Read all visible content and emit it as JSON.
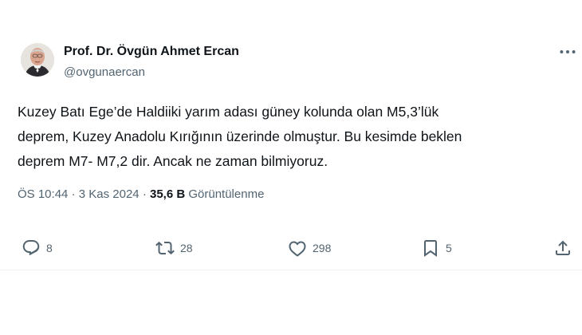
{
  "tweet": {
    "author_name": "Prof. Dr. Övgün Ahmet Ercan",
    "author_handle": "@ovgunaercan",
    "text": "Kuzey Batı Ege’de Haldiiki yarım adası güney kolunda olan M5,3’lük\ndeprem, Kuzey Anadolu Kırığının üzerinde olmuştur. Bu kesimde beklen\ndeprem M7- M7,2 dir. Ancak ne zaman bilmiyoruz.",
    "time": "ÖS 10:44",
    "separator": "·",
    "date": "3 Kas 2024",
    "views_count": "35,6 B",
    "views_label": "Görüntülenme"
  },
  "actions": {
    "replies": "8",
    "reposts": "28",
    "likes": "298",
    "bookmarks": "5"
  },
  "icons": {
    "more": "more-icon",
    "reply": "reply-icon",
    "repost": "repost-icon",
    "like": "heart-icon",
    "bookmark": "bookmark-icon",
    "share": "share-icon"
  },
  "colors": {
    "text": "#0f1419",
    "secondary": "#536471"
  }
}
